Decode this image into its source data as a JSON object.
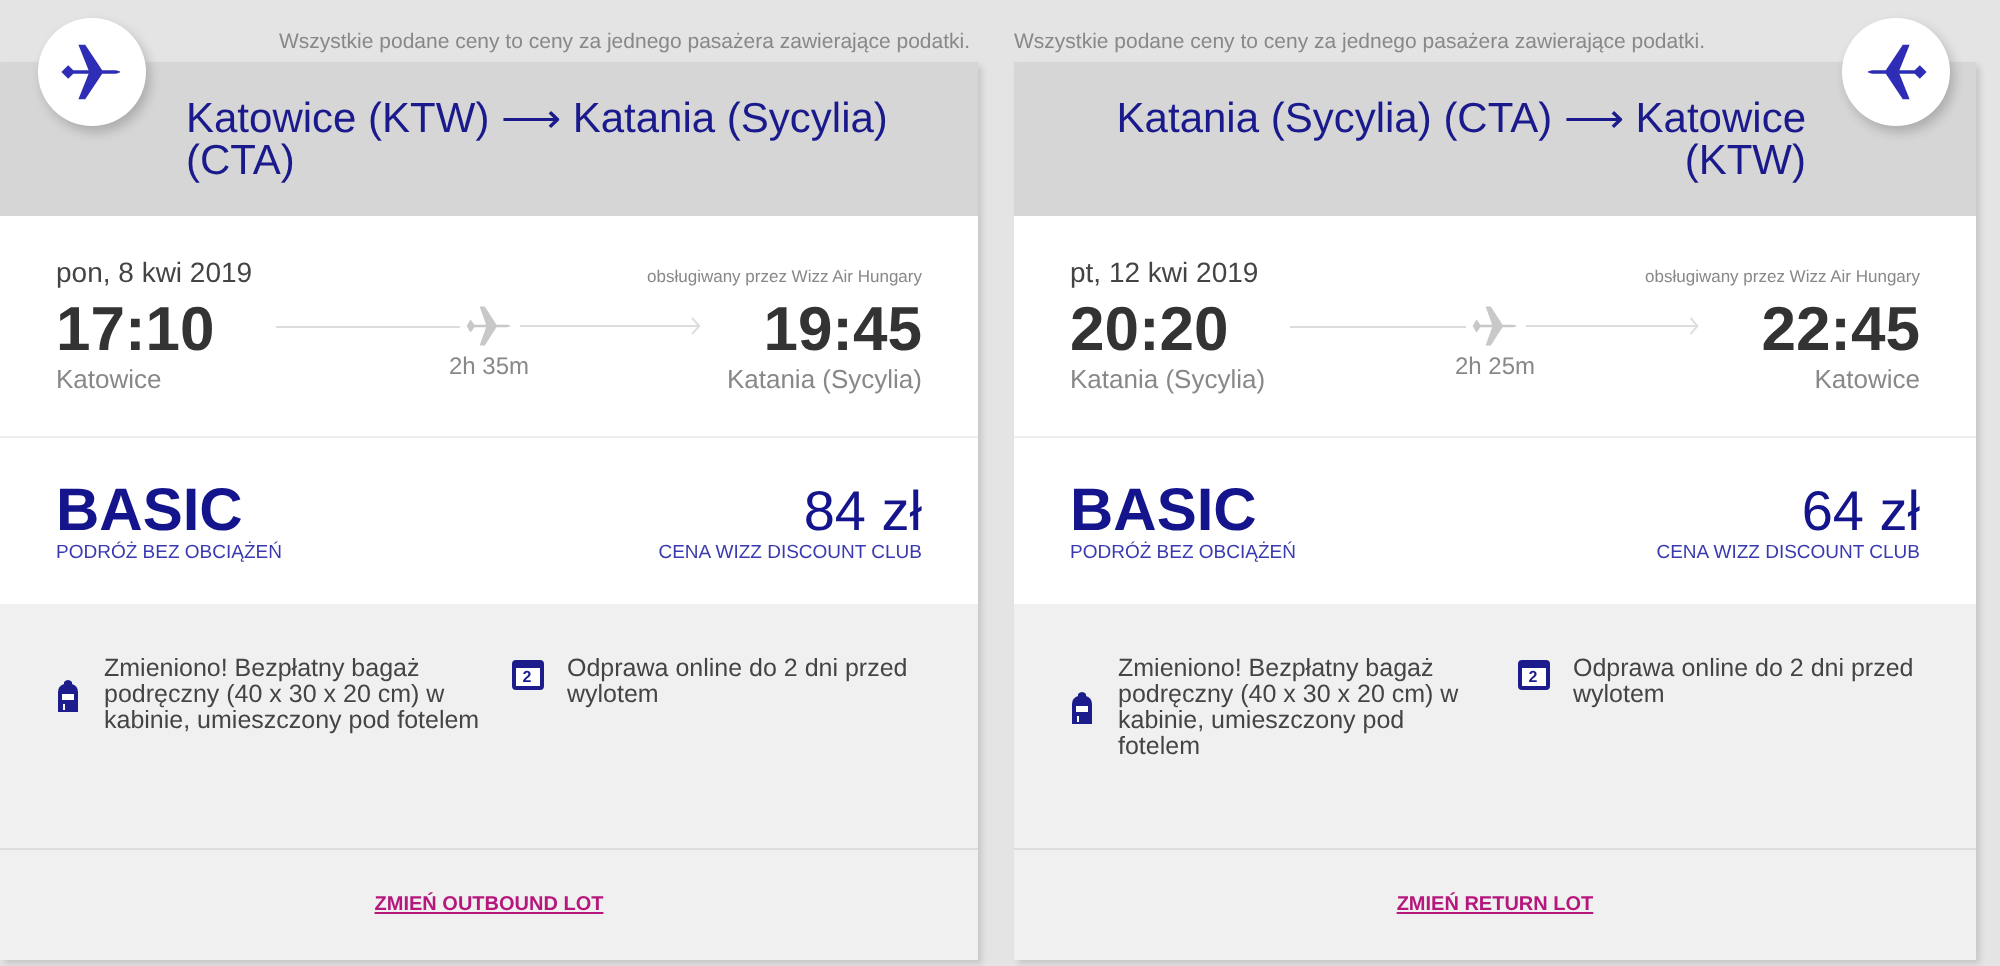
{
  "legs": [
    {
      "notice": "Wszystkie podane ceny to ceny za jednego pasażera zawierające podatki.",
      "badge_on_right": false,
      "route_from": "Katowice (KTW)",
      "route_arrow": "⟶",
      "route_to": "Katania (Sycylia) (CTA)",
      "date": "pon, 8 kwi 2019",
      "operator": "obsługiwany przez Wizz Air Hungary",
      "depart_time": "17:10",
      "depart_city": "Katowice",
      "duration": "2h 35m",
      "arrive_time": "19:45",
      "arrive_city": "Katania (Sycylia)",
      "fare": "BASIC",
      "fare_note": "PODRÓŻ BEZ OBCIĄŻEŃ",
      "price": "84 zł",
      "price_note": "CENA WIZZ DISCOUNT CLUB",
      "features": [
        {
          "kind": "bag",
          "text": "Zmieniono! Bezpłatny bagaż podręczny (40 x 30 x 20 cm) w kabinie, umieszczony pod fotelem"
        },
        {
          "kind": "calendar",
          "icon_text": "2",
          "text": "Odprawa online do 2 dni przed wylotem"
        }
      ],
      "change_link": "ZMIEŃ OUTBOUND LOT"
    },
    {
      "notice": "Wszystkie podane ceny to ceny za jednego pasażera zawierające podatki.",
      "badge_on_right": true,
      "route_from": "Katania (Sycylia) (CTA)",
      "route_arrow": "⟶",
      "route_to": "Katowice (KTW)",
      "date": "pt, 12 kwi 2019",
      "operator": "obsługiwany przez Wizz Air Hungary",
      "depart_time": "20:20",
      "depart_city": "Katania (Sycylia)",
      "duration": "2h 25m",
      "arrive_time": "22:45",
      "arrive_city": "Katowice",
      "fare": "BASIC",
      "fare_note": "PODRÓŻ BEZ OBCIĄŻEŃ",
      "price": "64 zł",
      "price_note": "CENA WIZZ DISCOUNT CLUB",
      "features": [
        {
          "kind": "bag",
          "text": "Zmieniono! Bezpłatny bagaż podręczny (40 x 30 x 20 cm) w kabinie, umieszczony pod fotelem"
        },
        {
          "kind": "calendar",
          "icon_text": "2",
          "text": "Odprawa online do 2 dni przed wylotem"
        }
      ],
      "change_link": "ZMIEŃ RETURN LOT"
    }
  ]
}
